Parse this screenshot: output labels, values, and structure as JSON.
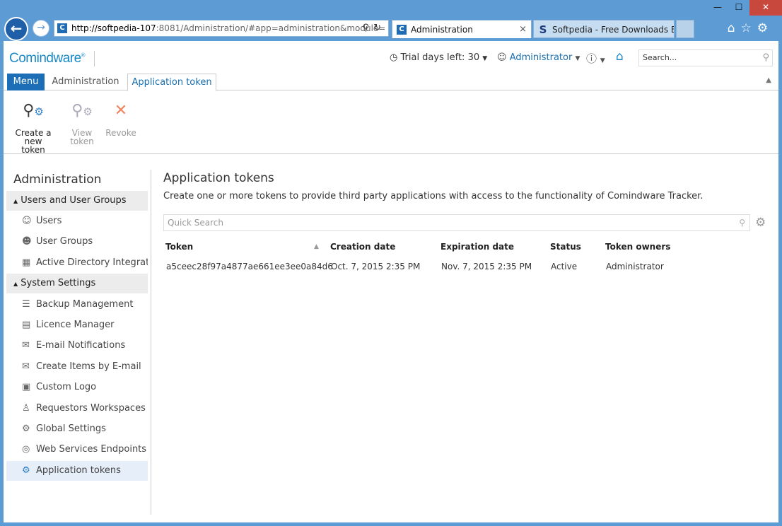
{
  "browser": {
    "address_host": "http://softpedia-107",
    "address_path": ":8081/Administration/#app=administration&module=",
    "tabs": [
      {
        "label": "Administration",
        "favicon": "C"
      },
      {
        "label": "Softpedia - Free Downloads En...",
        "favicon": "S"
      }
    ],
    "tab_close": "×",
    "window_buttons": {
      "minimize": "—",
      "maximize": "☐",
      "close": "✕"
    }
  },
  "header": {
    "logo": "Comindware",
    "trial": "Trial days left: 30",
    "user": "Administrator",
    "search_placeholder": "Search..."
  },
  "ribbon_tabs": {
    "menu": "Menu",
    "administration": "Administration",
    "application_token": "Application token"
  },
  "ribbon": {
    "create_line1": "Create a new",
    "create_line2": "token",
    "view_line1": "View",
    "view_line2": "token",
    "revoke": "Revoke"
  },
  "sidebar": {
    "title": "Administration",
    "group_users": "Users and User Groups",
    "group_system": "System Settings",
    "items": [
      {
        "label": "Users",
        "icon": "user-icon"
      },
      {
        "label": "User Groups",
        "icon": "user-group-icon"
      },
      {
        "label": "Active Directory Integrati...",
        "icon": "active-directory-icon"
      },
      {
        "label": "Backup Management",
        "icon": "backup-icon"
      },
      {
        "label": "Licence Manager",
        "icon": "licence-icon"
      },
      {
        "label": "E-mail Notifications",
        "icon": "email-icon"
      },
      {
        "label": "Create Items by E-mail",
        "icon": "email-create-icon"
      },
      {
        "label": "Custom Logo",
        "icon": "logo-icon"
      },
      {
        "label": "Requestors Workspaces",
        "icon": "workspace-icon"
      },
      {
        "label": "Global Settings",
        "icon": "gear-icon"
      },
      {
        "label": "Web Services Endpoints",
        "icon": "globe-icon"
      },
      {
        "label": "Application tokens",
        "icon": "token-icon"
      }
    ]
  },
  "main": {
    "title": "Application tokens",
    "description": "Create one or more tokens to provide third party applications with access to the functionality of Comindware Tracker.",
    "quick_search_placeholder": "Quick Search",
    "columns": [
      "Token",
      "Creation date",
      "Expiration date",
      "Status",
      "Token owners"
    ],
    "rows": [
      [
        "a5ceec28f97a4877ae661ee3ee0a84d6",
        "Oct. 7, 2015 2:35 PM",
        "Nov. 7, 2015 2:35 PM",
        "Active",
        "Administrator"
      ]
    ]
  },
  "colors": {
    "chrome": "#5d9bd4",
    "accent": "#1c6fb6",
    "logo": "#1a87c9",
    "revoke": "#f0855d"
  }
}
